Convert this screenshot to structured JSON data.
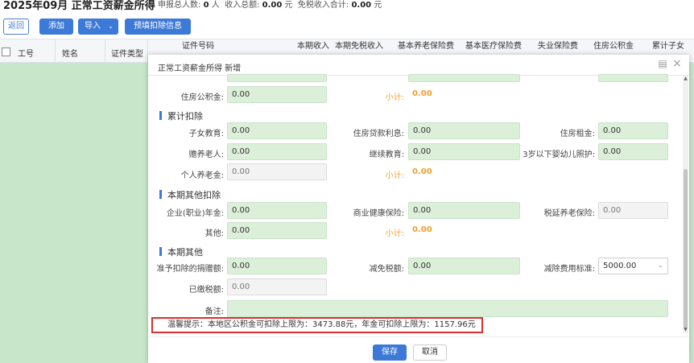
{
  "page": {
    "title": "2025年09月 正常工资薪金所得",
    "stats": {
      "count_label": "申报总人数:",
      "count_value": "0",
      "count_unit": "人",
      "income_label": "收入总额:",
      "income_value": "0.00",
      "income_unit": "元",
      "taxfree_label": "免税收入合计:",
      "taxfree_value": "0.00",
      "taxfree_unit": "元"
    }
  },
  "toolbar": {
    "back": "返回",
    "add": "添加",
    "import": "导入",
    "prefill": "预填扣除信息"
  },
  "grid": {
    "columns": [
      "工号",
      "姓名",
      "证件类型",
      "证件号码",
      "本期收入",
      "本期免税收入",
      "基本养老保险费",
      "基本医疗保险费",
      "失业保险费",
      "住房公积金",
      "累计子女"
    ]
  },
  "modal": {
    "title": "正常工资薪金所得 新增",
    "row_top": {
      "housing_fund_label": "住房公积金:",
      "housing_fund_value": "0.00",
      "subtotal_label": "小计:",
      "subtotal_value": "0.00"
    },
    "sections": {
      "cumulative": "累计扣除",
      "other_deductions": "本期其他扣除",
      "other": "本期其他"
    },
    "cumulative": {
      "child_edu_label": "子女教育:",
      "child_edu_value": "0.00",
      "loan_label": "住房贷款利息:",
      "loan_value": "0.00",
      "rent_label": "住房租金:",
      "rent_value": "0.00",
      "elderly_label": "赡养老人:",
      "elderly_value": "0.00",
      "continuing_label": "继续教育:",
      "continuing_value": "0.00",
      "infant_label": "3岁以下婴幼儿照护:",
      "infant_value": "0.00",
      "pension_label": "个人养老金:",
      "pension_value": "0.00",
      "subtotal_label": "小计:",
      "subtotal_value": "0.00"
    },
    "other_deductions": {
      "annuity_label": "企业(职业)年金:",
      "annuity_value": "0.00",
      "health_label": "商业健康保险:",
      "health_value": "0.00",
      "deferred_label": "税延养老保险:",
      "deferred_value": "0.00",
      "other_label": "其他:",
      "other_value": "0.00",
      "subtotal_label": "小计:",
      "subtotal_value": "0.00"
    },
    "other": {
      "donation_label": "准予扣除的捐赠额:",
      "donation_value": "0.00",
      "reduce_label": "减免税额:",
      "reduce_value": "0.00",
      "standard_label": "减除费用标准:",
      "standard_value": "5000.00",
      "paid_label": "已缴税额:",
      "paid_value": "0.00",
      "remark_label": "备注:",
      "remark_value": ""
    },
    "tip": "温馨提示：本地区公积金可扣除上限为：3473.88元，年金可扣除上限为：1157.96元",
    "save": "保存",
    "cancel": "取消"
  },
  "icons": {
    "maximize": "maximize-icon",
    "close": "close-icon",
    "dropdown": "chevron-down-icon"
  },
  "colors": {
    "accent": "#3d79d6",
    "grid_bg": "#c8e6c9",
    "input_bg": "#dcefd9",
    "subtotal": "#f0a030",
    "tip_border": "#d83030"
  }
}
